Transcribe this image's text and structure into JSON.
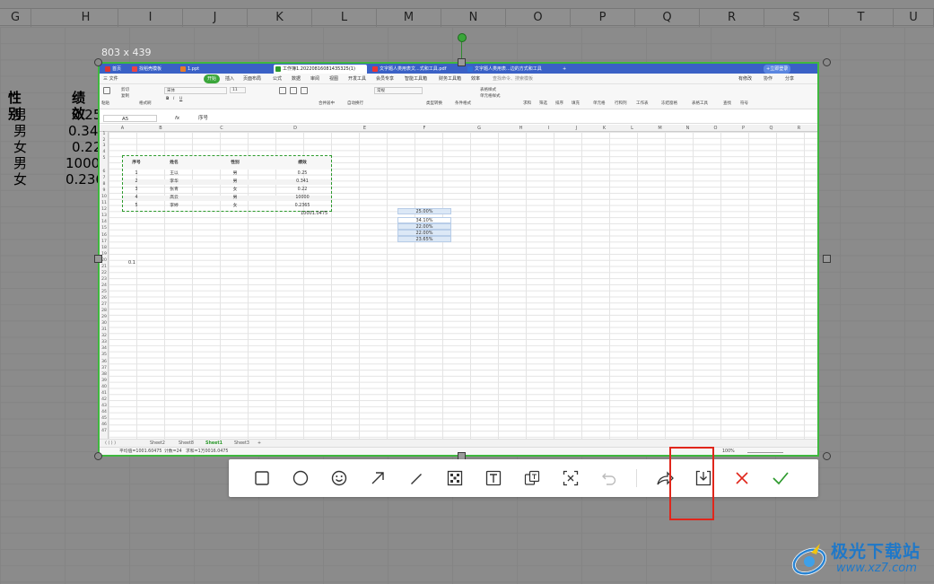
{
  "background_sheet": {
    "columns": [
      "G",
      "H",
      "I",
      "J",
      "K",
      "L",
      "M",
      "N",
      "O",
      "P",
      "Q",
      "R",
      "S",
      "T",
      "U"
    ],
    "header_gender": "性别",
    "header_perf": "绩效",
    "rows": [
      {
        "gender": "男",
        "perf": "0.25"
      },
      {
        "gender": "男",
        "perf": "0.34"
      },
      {
        "gender": "女",
        "perf": "0.22"
      },
      {
        "gender": "男",
        "perf": "1000"
      },
      {
        "gender": "女",
        "perf": "0.236"
      }
    ]
  },
  "selection": {
    "dimensions": "803 x 439"
  },
  "screenshot": {
    "tabs": [
      {
        "label": "首页",
        "color": "#d33"
      },
      {
        "label": "找稻壳模板",
        "color": "#e44"
      },
      {
        "label": "1.ppt",
        "color": "#e87c2a"
      },
      {
        "label": "工作簿1.20220816081435325(1)",
        "color": "#2e9a2e"
      },
      {
        "label": "文字题人类用表文...式和工具.pdf",
        "color": "#e33"
      },
      {
        "label": "文字题人类用表...边的方式和工具",
        "color": "#2f6fd6"
      }
    ],
    "login_label": "+立即登录",
    "menu": [
      "三 文件",
      "开始",
      "插入",
      "页面布局",
      "公式",
      "数据",
      "审阅",
      "视图",
      "开发工具",
      "会员专享",
      "智能工具箱",
      "财务工具箱",
      "效率"
    ],
    "search_placeholder": "查找命令、搜索模板",
    "right_actions": [
      "有修改",
      "协作",
      "分享"
    ],
    "ribbon": {
      "font_name": "宋体",
      "font_size": "11",
      "number_format": "常规",
      "labels": [
        "剪切",
        "复制",
        "格式刷",
        "粘贴",
        "合并居中",
        "自动换行",
        "类型转换",
        "条件格式",
        "单元格样式",
        "表格样式",
        "求和",
        "筛选",
        "排序",
        "填充",
        "单元格",
        "行和列",
        "工作表",
        "冻结窗格",
        "表格工具",
        "查找",
        "符号"
      ]
    },
    "cell_ref": "A5",
    "formula_text": "序号",
    "col_headers": [
      "A",
      "B",
      "C",
      "D",
      "E",
      "F",
      "G",
      "H",
      "I",
      "J",
      "K",
      "L",
      "M",
      "N",
      "O",
      "P",
      "Q",
      "R"
    ],
    "row_numbers": [
      "1",
      "2",
      "3",
      "4",
      "5",
      "6",
      "7",
      "8",
      "9",
      "10",
      "11",
      "12",
      "13",
      "14",
      "15",
      "16",
      "17",
      "18",
      "19",
      "20",
      "21",
      "22",
      "23",
      "24",
      "25",
      "26",
      "27",
      "28",
      "29",
      "30",
      "31",
      "32",
      "33",
      "34",
      "35",
      "36",
      "37",
      "38",
      "39",
      "40",
      "41",
      "42",
      "43",
      "44",
      "45",
      "46",
      "47"
    ],
    "table_headers": [
      "序号",
      "姓名",
      "性别",
      "绩效"
    ],
    "table_rows": [
      [
        "1",
        "王以",
        "男",
        "0.25"
      ],
      [
        "2",
        "李华",
        "男",
        "0.341"
      ],
      [
        "3",
        "张青",
        "女",
        "0.22"
      ],
      [
        "4",
        "高云",
        "男",
        "10000"
      ],
      [
        "5",
        "李婷",
        "女",
        "0.2365"
      ]
    ],
    "sum_value": "10001.0475",
    "small_value": "0.1",
    "percentages": [
      "25.00%",
      "34.10%",
      "22.00%",
      "22.00%",
      "23.65%"
    ],
    "sheet_tabs": [
      "Sheet2",
      "Sheet8",
      "Sheet1",
      "Sheet3"
    ],
    "active_sheet": "Sheet1",
    "status": {
      "average": "平均值=1001.60475",
      "count": "计数=24",
      "sum": "求和=1万0016.0475",
      "zoom": "100%"
    }
  },
  "toolbar": {
    "tools": [
      {
        "name": "rectangle",
        "icon": "rectangle-icon"
      },
      {
        "name": "ellipse",
        "icon": "ellipse-icon"
      },
      {
        "name": "emoji",
        "icon": "emoji-icon"
      },
      {
        "name": "arrow",
        "icon": "arrow-icon"
      },
      {
        "name": "pen",
        "icon": "pen-icon"
      },
      {
        "name": "mosaic",
        "icon": "mosaic-icon"
      },
      {
        "name": "text",
        "icon": "text-icon"
      },
      {
        "name": "translate",
        "icon": "translate-icon"
      },
      {
        "name": "ocr",
        "icon": "ocr-icon"
      },
      {
        "name": "undo",
        "icon": "undo-icon"
      },
      {
        "name": "share",
        "icon": "share-icon"
      },
      {
        "name": "save",
        "icon": "download-icon"
      },
      {
        "name": "cancel",
        "icon": "close-icon"
      },
      {
        "name": "confirm",
        "icon": "check-icon"
      }
    ],
    "highlight_color": "#e0261b",
    "cancel_color": "#e0261b",
    "confirm_color": "#2e9a2e"
  },
  "watermark": {
    "title": "极光下载站",
    "url": "www.xz7.com"
  }
}
